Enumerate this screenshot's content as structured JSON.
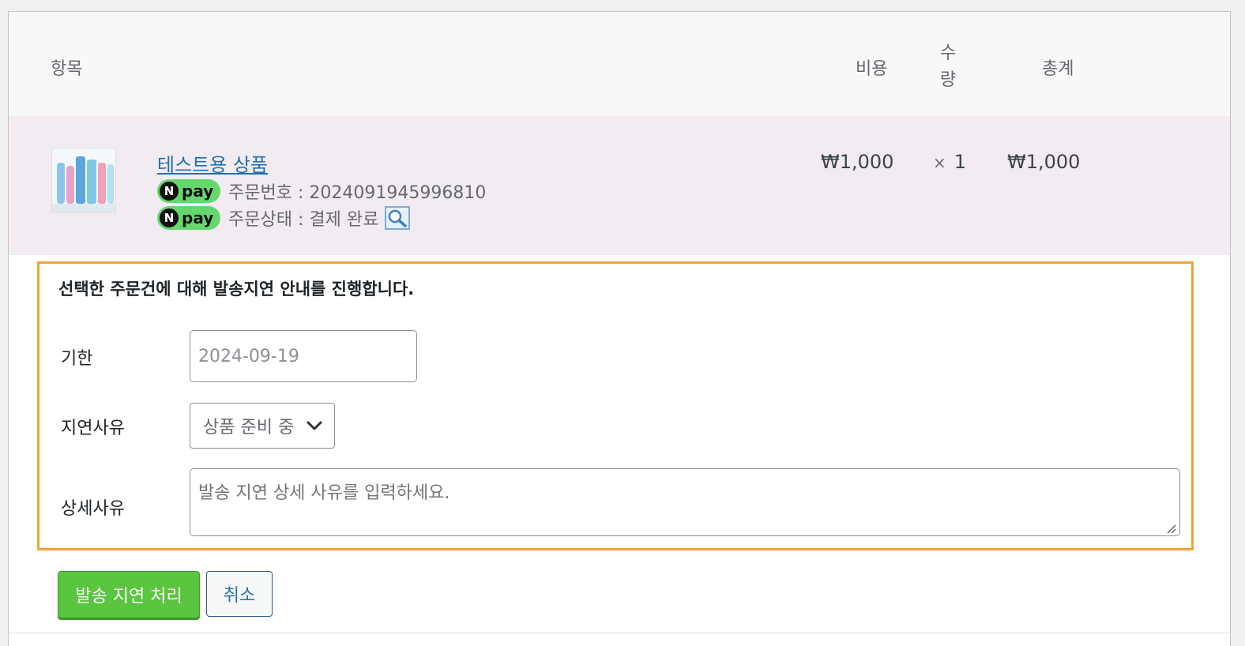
{
  "table": {
    "headers": {
      "item": "항목",
      "cost": "비용",
      "qty_line1": "수",
      "qty_line2": "량",
      "total": "총계"
    },
    "row": {
      "product_name": "테스트용 상품",
      "npay_label": "pay",
      "npay_n": "N",
      "order_number": "주문번호 : 2024091945996810",
      "order_status": "주문상태 : 결제 완료",
      "cost": "₩1,000",
      "qty_times": "×",
      "qty": "1",
      "total": "₩1,000"
    }
  },
  "delay_form": {
    "notice": "선택한 주문건에 대해 발송지연 안내를 진행합니다.",
    "deadline_label": "기한",
    "deadline_value": "2024-09-19",
    "reason_label": "지연사유",
    "reason_selected": "상품 준비 중",
    "detail_label": "상세사유",
    "detail_placeholder": "발송 지연 상세 사유를 입력하세요."
  },
  "actions": {
    "submit_label": "발송 지연 처리",
    "cancel_label": "취소"
  },
  "colors": {
    "highlight_border": "#f0a33a",
    "npay_green": "#65d86d",
    "primary_button": "#5ac53f",
    "link": "#2271b1",
    "row_background": "#f2ecf2"
  },
  "icons": [
    "product-thumbnail",
    "npay-logo",
    "search-icon",
    "chevron-down-icon",
    "resize-grip-icon"
  ]
}
